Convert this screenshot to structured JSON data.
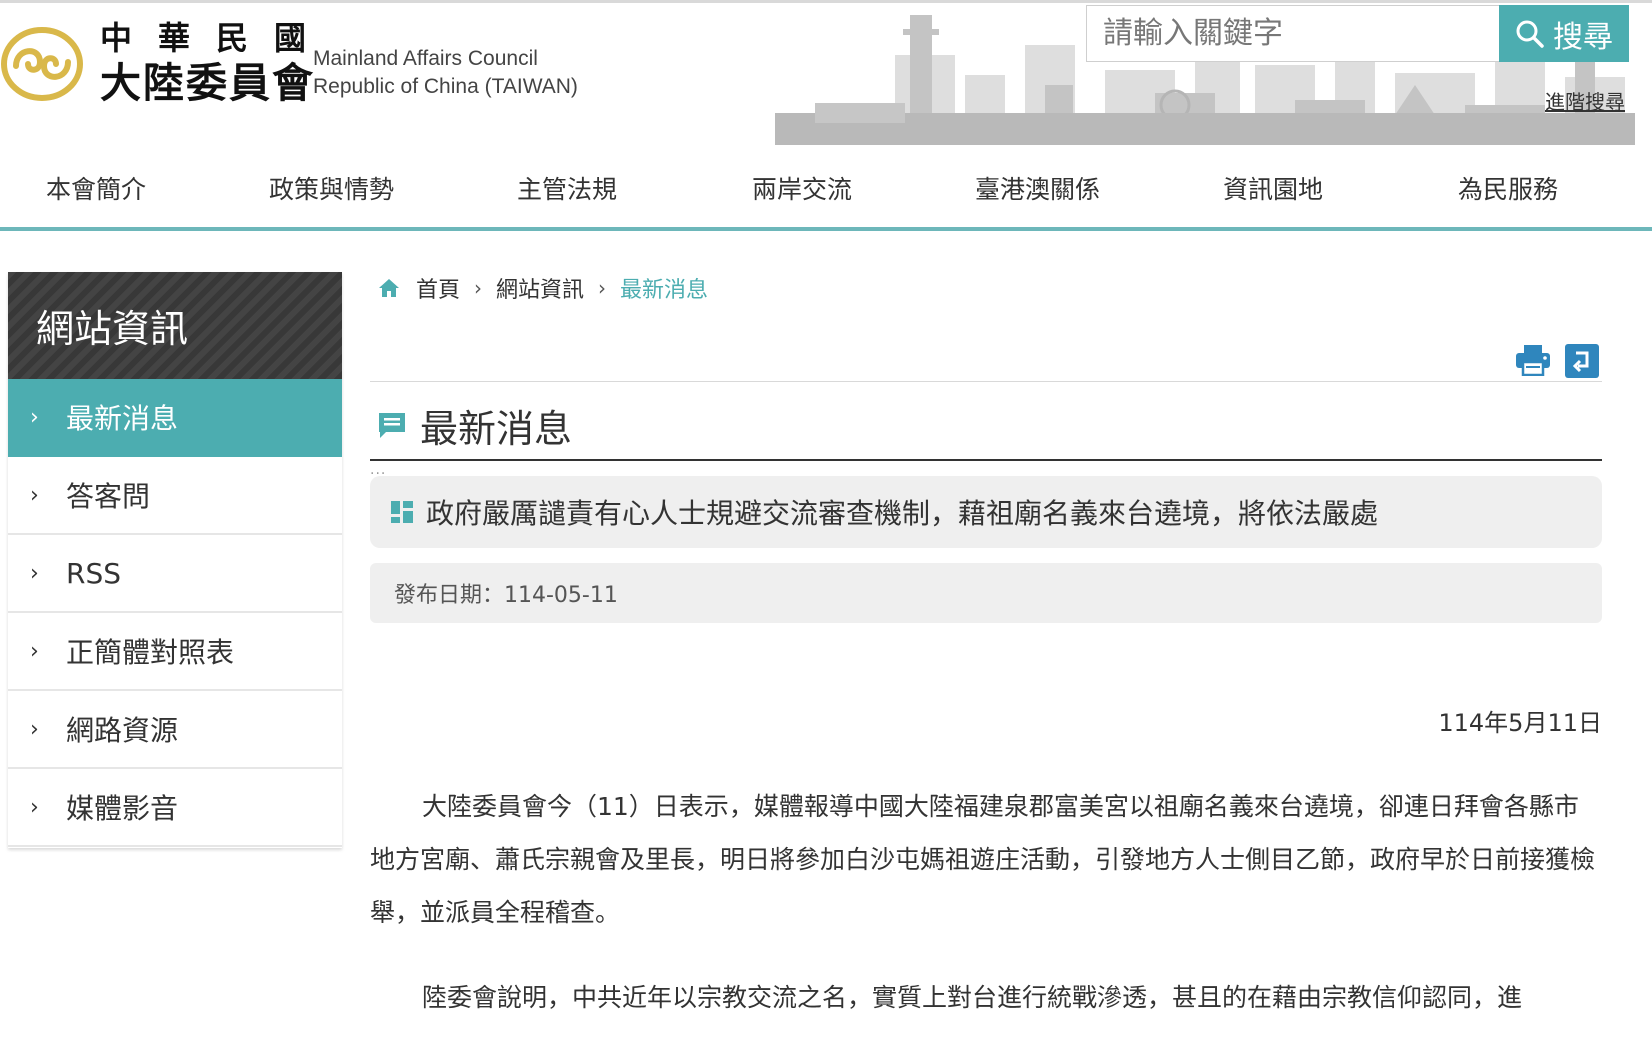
{
  "header": {
    "logo_cn_line1": "中華民國",
    "logo_cn_line2": "大陸委員會",
    "logo_en_line1": "Mainland Affairs Council",
    "logo_en_line2": "Republic of China (TAIWAN)",
    "search_placeholder": "請輸入關鍵字",
    "search_button": "搜尋",
    "advanced_search": "進階搜尋"
  },
  "nav": {
    "items": [
      "本會簡介",
      "政策與情勢",
      "主管法規",
      "兩岸交流",
      "臺港澳關係",
      "資訊園地",
      "為民服務"
    ]
  },
  "sidebar": {
    "title": "網站資訊",
    "items": [
      "最新消息",
      "答客問",
      "RSS",
      "正簡體對照表",
      "網路資源",
      "媒體影音"
    ],
    "active_index": 0
  },
  "breadcrumb": {
    "home": "首頁",
    "level1": "網站資訊",
    "current": "最新消息"
  },
  "page": {
    "title": "最新消息",
    "dots": "...",
    "article_title": "政府嚴厲譴責有心人士規避交流審查機制，藉祖廟名義來台遶境，將依法嚴處",
    "publish_date": "發布日期：114-05-11",
    "date_right": "114年5月11日",
    "paragraphs": [
      "大陸委員會今（11）日表示，媒體報導中國大陸福建泉郡富美宮以祖廟名義來台遶境，卻連日拜會各縣市地方宮廟、蕭氏宗親會及里長，明日將參加白沙屯媽祖遊庄活動，引發地方人士側目乙節，政府早於日前接獲檢舉，並派員全程稽查。",
      "陸委會說明，中共近年以宗教交流之名，實質上對台進行統戰滲透，甚且的在藉由宗教信仰認同，進"
    ]
  },
  "colors": {
    "accent": "#4cadb0",
    "sidebar_title_bg": "#3d3d3d",
    "logo_gold": "#d9b84a"
  },
  "icons": {
    "search": "search-icon",
    "home": "home-icon",
    "print": "print-icon",
    "back": "back-icon",
    "title": "message-icon",
    "article": "grid-icon"
  }
}
